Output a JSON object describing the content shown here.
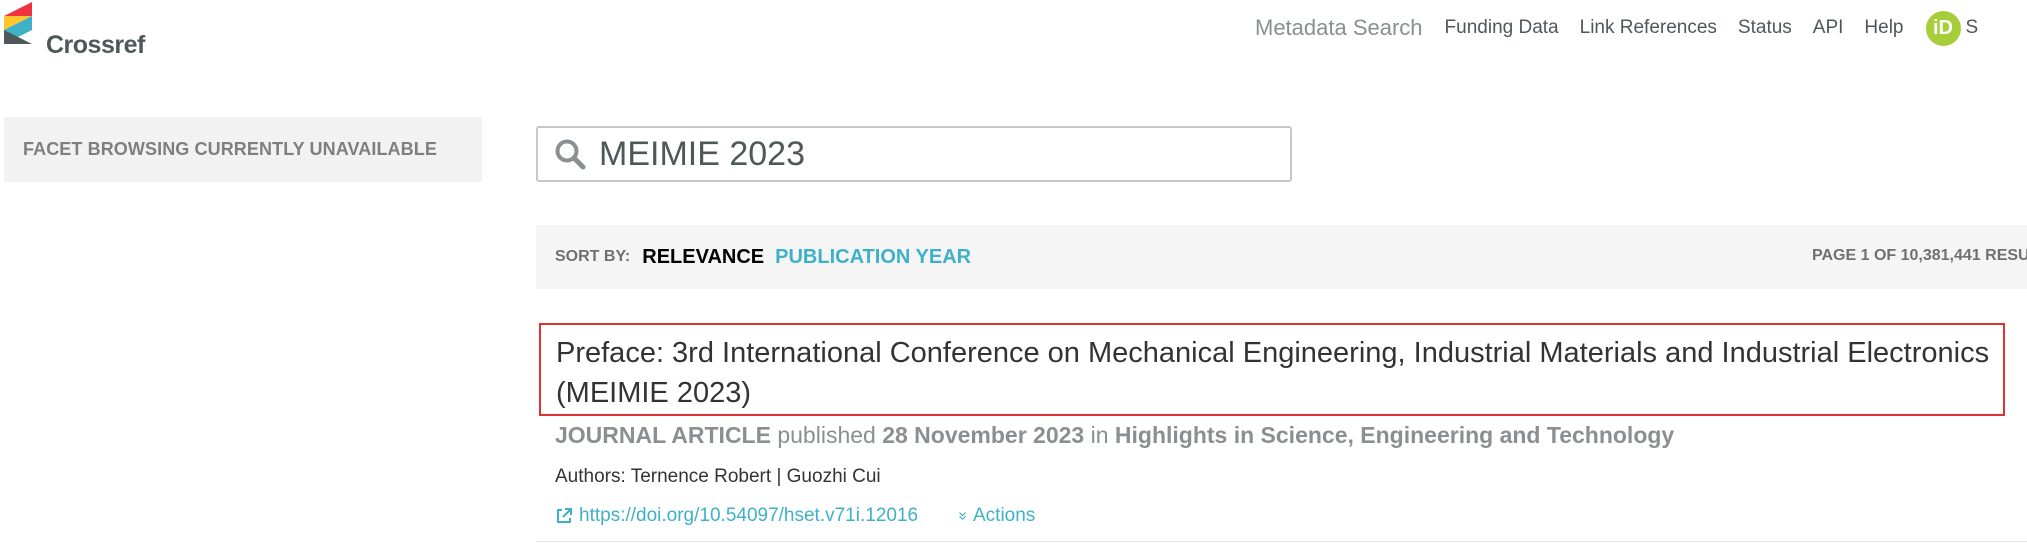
{
  "header": {
    "logo_text": "Crossref",
    "nav": {
      "metadata_search": "Metadata Search",
      "funding_data": "Funding Data",
      "link_references": "Link References",
      "status": "Status",
      "api": "API",
      "help": "Help",
      "orcid_badge": "iD",
      "orcid_label": "S"
    }
  },
  "sidebar": {
    "facet_message": "FACET BROWSING CURRENTLY UNAVAILABLE"
  },
  "search": {
    "value": "MEIMIE 2023"
  },
  "sort": {
    "label": "SORT BY:",
    "relevance": "RELEVANCE",
    "publication_year": "PUBLICATION YEAR",
    "page_info": "PAGE 1 OF 10,381,441 RESU"
  },
  "result": {
    "title": "Preface: 3rd International Conference on Mechanical Engineering, Industrial Materials and Industrial Electronics (MEIMIE 2023)",
    "type": "JOURNAL ARTICLE",
    "published_word": "published",
    "date": "28 November 2023",
    "in_word": "in",
    "journal": "Highlights in Science, Engineering and Technology",
    "authors": "Authors: Ternence Robert | Guozhi Cui",
    "doi": "https://doi.org/10.54097/hset.v71i.12016",
    "actions": "Actions"
  },
  "colors": {
    "accent": "#3eb1c8",
    "highlight_border": "#e03030",
    "orcid": "#a6ce39"
  }
}
